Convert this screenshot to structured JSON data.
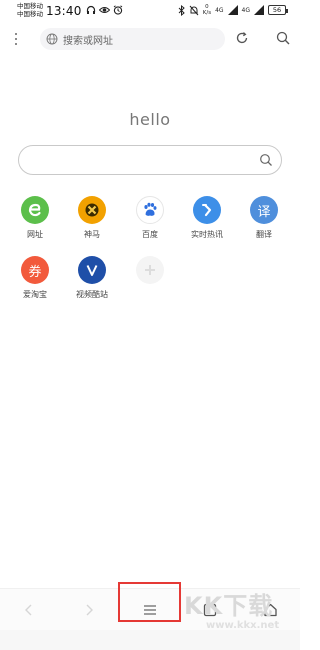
{
  "status_bar": {
    "carrier_1": "中国移动",
    "carrier_2": "中国移动",
    "time": "13:40",
    "net_speed_value": "0",
    "net_speed_unit": "K/s",
    "signal_1": "4G",
    "signal_2": "4G",
    "battery": "56"
  },
  "top_bar": {
    "address_placeholder": "搜索或网址"
  },
  "main": {
    "greeting": "hello"
  },
  "shortcuts": [
    {
      "label": "网址",
      "glyph": "e",
      "color": "#5cbf4b",
      "icon": "globe-e-icon"
    },
    {
      "label": "神马",
      "glyph": "✕",
      "color": "#f2a100",
      "icon": "shenma-icon"
    },
    {
      "label": "百度",
      "glyph": "🐾",
      "color": "#ffffff",
      "icon": "baidu-paw-icon"
    },
    {
      "label": "实时热讯",
      "glyph": "↰",
      "color": "#3d8fe8",
      "icon": "hot-news-icon"
    },
    {
      "label": "翻译",
      "glyph": "译",
      "color": "#4f8fdc",
      "icon": "translate-icon"
    },
    {
      "label": "爱淘宝",
      "glyph": "券",
      "color": "#f25a3c",
      "icon": "taobao-coupon-icon"
    },
    {
      "label": "视频酷站",
      "glyph": "V",
      "color": "#1f4fa8",
      "icon": "video-site-icon"
    },
    {
      "label": "",
      "glyph": "+",
      "color": "#f4f4f4",
      "icon": "add-shortcut-icon"
    }
  ],
  "watermark": {
    "main": "KK下载",
    "sub": "www.kkx.net"
  }
}
